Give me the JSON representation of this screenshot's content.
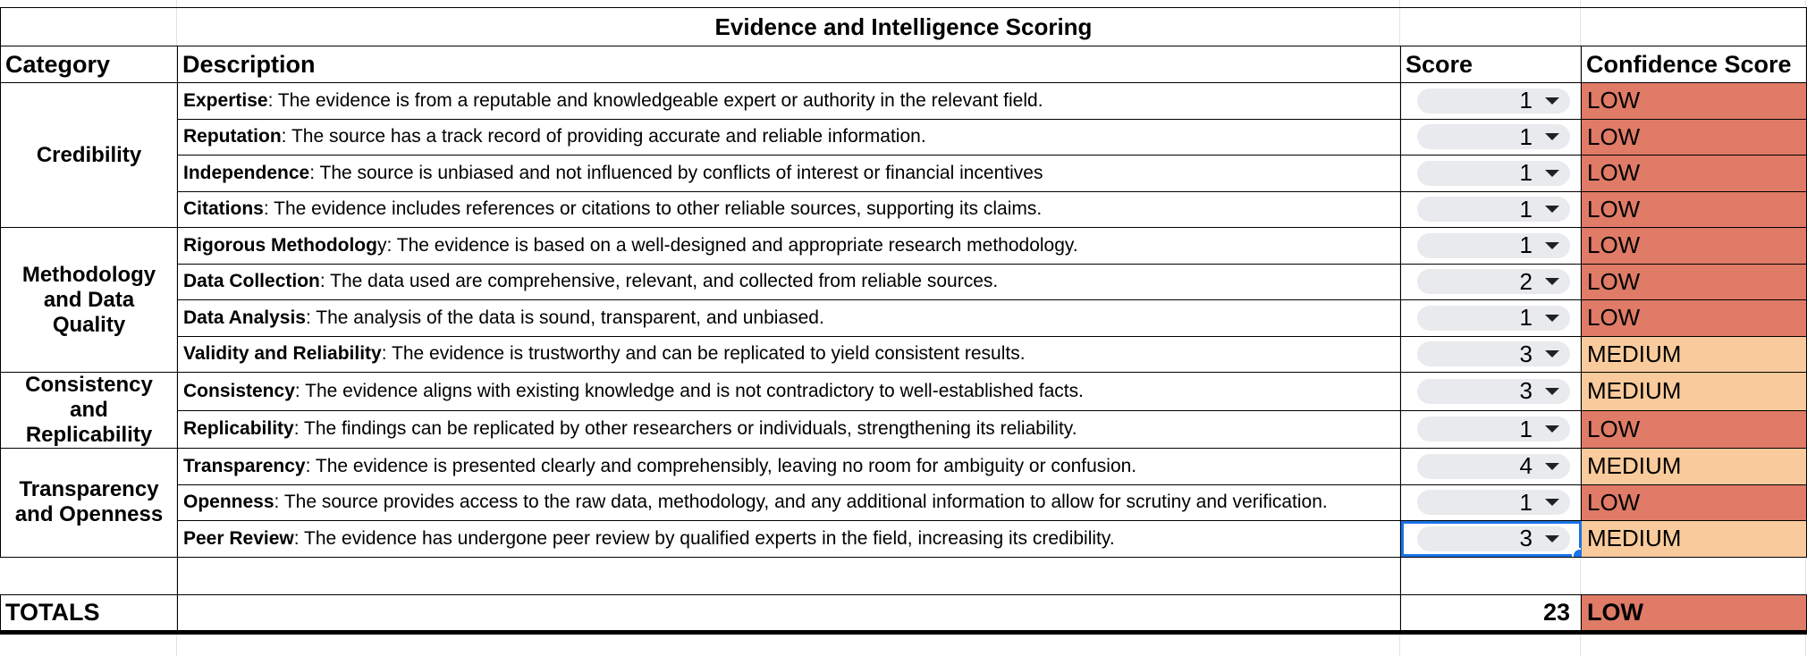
{
  "table": {
    "title": "Evidence and Intelligence Scoring",
    "headers": [
      "Category",
      "Description",
      "Score",
      "Confidence Score"
    ],
    "categories": [
      "Credibility",
      "Methodology and Data Quality",
      "Consistency and Replicability",
      "Transparency and Openness"
    ],
    "rows": [
      {
        "term": "Expertise",
        "text": ": The evidence is from a reputable and knowledgeable expert or authority in the relevant field.",
        "score": "1",
        "confidence": "LOW"
      },
      {
        "term": "Reputation",
        "text": ": The source has a track record of providing accurate and reliable information.",
        "score": "1",
        "confidence": "LOW"
      },
      {
        "term": "Independence",
        "text": ": The source is unbiased and not influenced by conflicts of interest or financial incentives",
        "score": "1",
        "confidence": "LOW"
      },
      {
        "term": "Citations",
        "text": ": The evidence includes references or citations to other reliable sources, supporting its claims.",
        "score": "1",
        "confidence": "LOW"
      },
      {
        "term": "Rigorous Methodolog",
        "text": "y: The evidence is based on a well-designed and appropriate research methodology.",
        "score": "1",
        "confidence": "LOW"
      },
      {
        "term": "Data Collection",
        "text": ": The data used are comprehensive, relevant, and collected from reliable sources.",
        "score": "2",
        "confidence": "LOW"
      },
      {
        "term": "Data Analysis",
        "text": ": The analysis of the data is sound, transparent, and unbiased.",
        "score": "1",
        "confidence": "LOW"
      },
      {
        "term": "Validity and Reliability",
        "text": ": The evidence is trustworthy and can be replicated to yield consistent results.",
        "score": "3",
        "confidence": "MEDIUM"
      },
      {
        "term": "Consistency",
        "text": ": The evidence aligns with existing knowledge and is not contradictory to well-established facts.",
        "score": "3",
        "confidence": "MEDIUM"
      },
      {
        "term": "Replicability",
        "text": ": The findings can be replicated by other researchers or individuals, strengthening its reliability.",
        "score": "1",
        "confidence": "LOW"
      },
      {
        "term": "Transparency",
        "text": ": The evidence is presented clearly and comprehensibly, leaving no room for ambiguity or confusion.",
        "score": "4",
        "confidence": "MEDIUM"
      },
      {
        "term": "Openness",
        "text": ": The source provides access to the raw data, methodology, and any additional information to allow for scrutiny and verification.",
        "score": "1",
        "confidence": "LOW"
      },
      {
        "term": "Peer Review",
        "text": ": The evidence has undergone peer review by qualified experts in the field, increasing its credibility.",
        "score": "3",
        "confidence": "MEDIUM"
      }
    ],
    "totals": {
      "label": "TOTALS",
      "score": "23",
      "confidence": "LOW"
    }
  },
  "colors": {
    "low": "#df7b67",
    "medium": "#f9cb9c",
    "selection": "#1a73e8",
    "chip": "#e8eaed"
  },
  "icons": {
    "dropdown": "caret-down-icon"
  }
}
